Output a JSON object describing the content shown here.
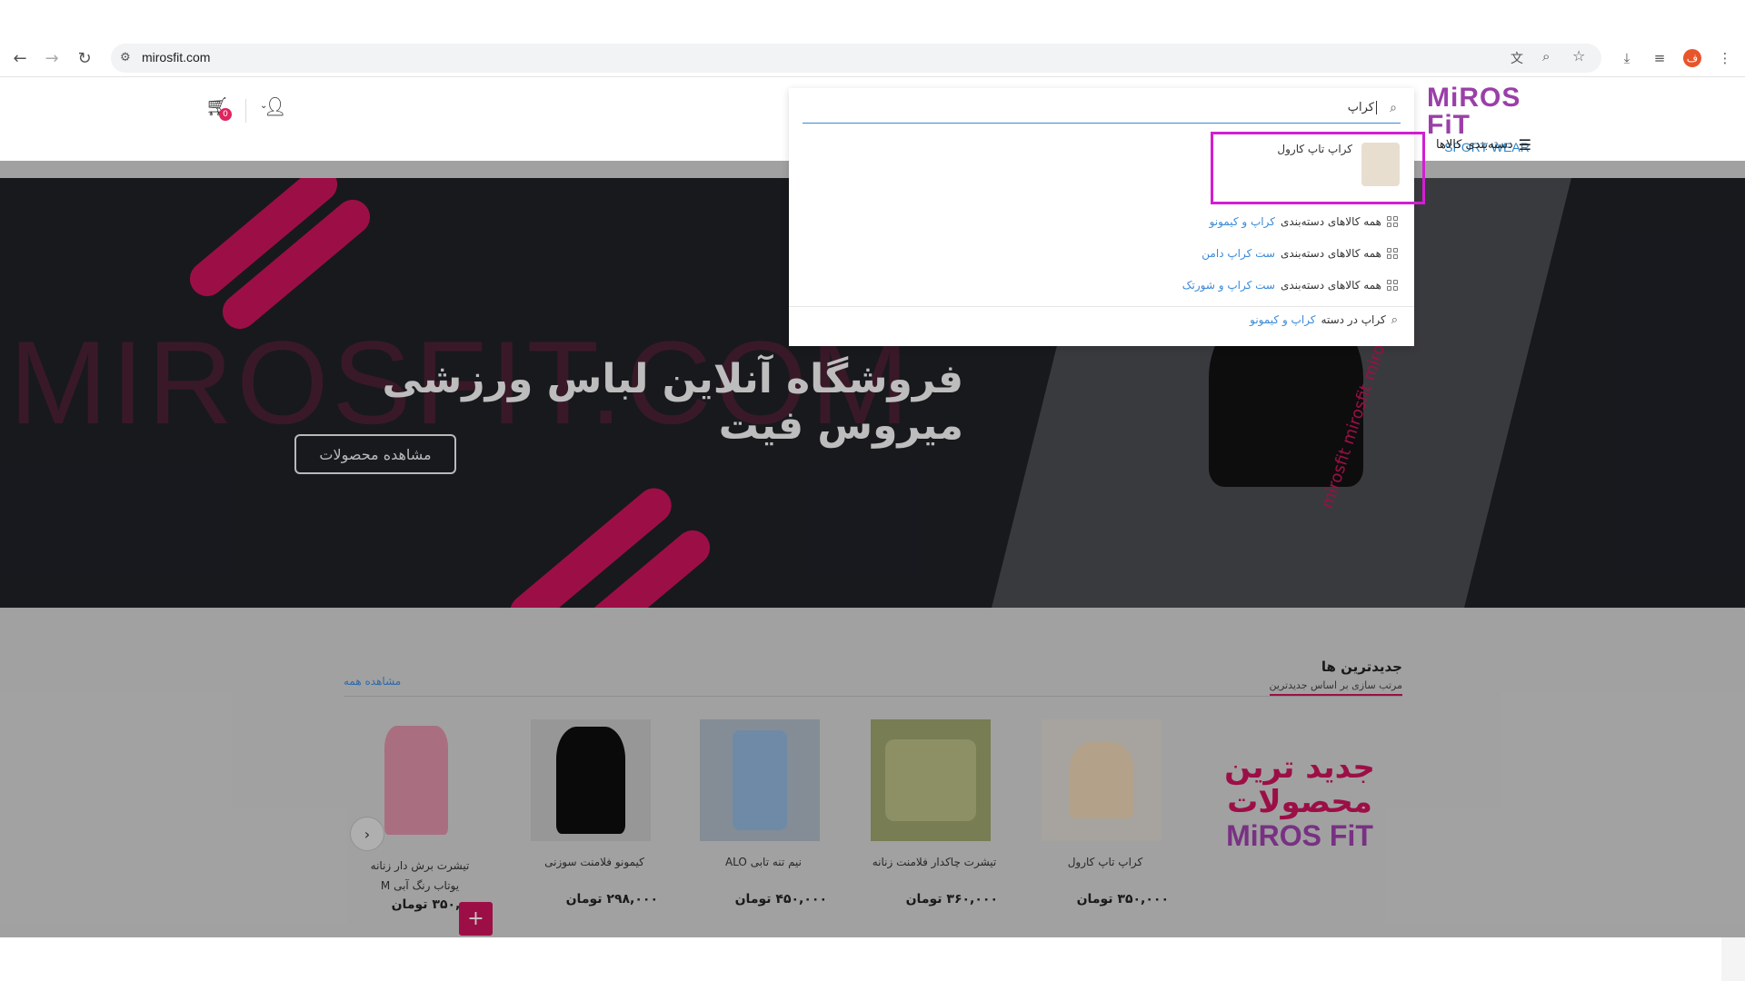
{
  "browser": {
    "url": "mirosfit.com",
    "profile_initial": "ف"
  },
  "header": {
    "logo_main": "MiROS FiT",
    "logo_sub": "SPORT WEAR",
    "categories_label": "دسته‌بندی کالاها",
    "cart_count": "0"
  },
  "search": {
    "query": "کراپ",
    "product_result": "کراپ تاپ کارول",
    "category_rows": [
      {
        "prefix": "همه کالاهای دسته‌بندی",
        "category": "کراپ و کیمونو"
      },
      {
        "prefix": "همه کالاهای دسته‌بندی",
        "category": "ست کراپ دامن"
      },
      {
        "prefix": "همه کالاهای دسته‌بندی",
        "category": "ست کراپ و شورتک"
      }
    ],
    "in_category": {
      "prefix": "کراپ در دسته",
      "category": "کراپ و کیمونو"
    }
  },
  "hero": {
    "watermark": "MIROSFIT.COM",
    "title": "فروشگاه آنلاین لباس ورزشی میروس فیت",
    "cta": "مشاهده محصولات",
    "side_text": "mirosfit mirosfit mirosfit"
  },
  "newest": {
    "title": "جدیدترین ها",
    "subtitle": "مرتب سازی بر اساس جدیدترین",
    "view_all": "مشاهده همه",
    "promo_line1": "جدید ترین",
    "promo_line2": "محصولات",
    "promo_brand": "MiROS FiT",
    "products": [
      {
        "name": "کراپ تاپ کارول",
        "price": "۳۵۰,۰۰۰ تومان"
      },
      {
        "name": "تیشرت چاکدار فلامنت زنانه",
        "price": "۳۶۰,۰۰۰ تومان"
      },
      {
        "name": "نیم تنه تابی ALO",
        "price": "۴۵۰,۰۰۰ تومان"
      },
      {
        "name": "کیمونو فلامنت سوزنی",
        "price": "۲۹۸,۰۰۰ تومان"
      },
      {
        "name": "تیشرت برش دار زنانه یوتاب رنگ آبی M",
        "price": "۳۵۰,۰۰۰ تومان"
      }
    ],
    "add_button": "+"
  }
}
